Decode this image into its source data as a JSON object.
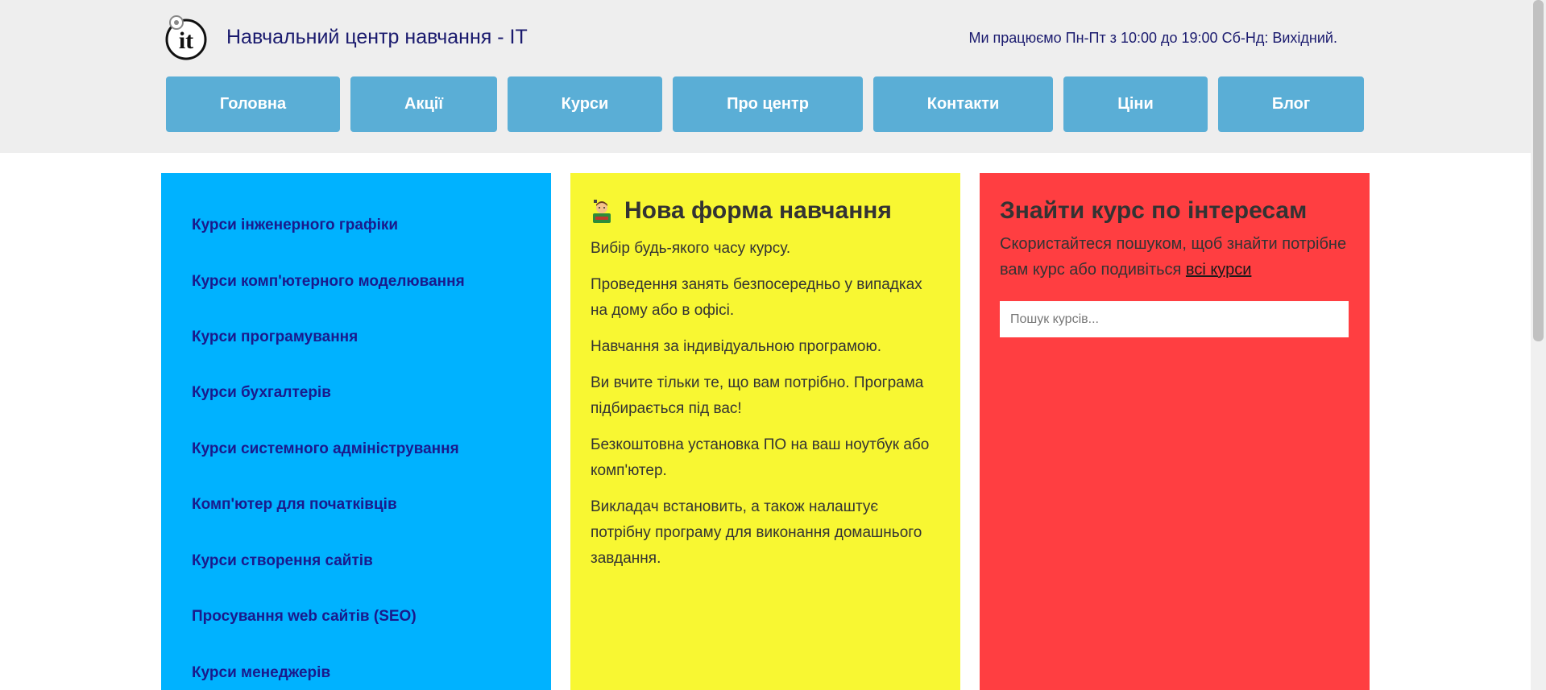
{
  "header": {
    "title": "Навчальний центр навчання - IT",
    "hours": "Ми працюємо Пн-Пт з 10:00 до 19:00 Сб-Нд: Вихідний.",
    "logo_text": "it"
  },
  "nav": [
    {
      "label": "Головна"
    },
    {
      "label": "Акції"
    },
    {
      "label": "Курси"
    },
    {
      "label": "Про центр"
    },
    {
      "label": "Контакти"
    },
    {
      "label": "Ціни"
    },
    {
      "label": "Блог"
    }
  ],
  "courses": [
    {
      "label": "Курси інженерного графіки"
    },
    {
      "label": "Курси комп'ютерного моделювання"
    },
    {
      "label": "Курси програмування"
    },
    {
      "label": "Курси бухгалтерів"
    },
    {
      "label": "Курси системного адміністрування"
    },
    {
      "label": "Комп'ютер для початківців"
    },
    {
      "label": "Курси створення сайтів"
    },
    {
      "label": "Просування web сайтів (SEO)"
    },
    {
      "label": "Курси менеджерів"
    }
  ],
  "new_form": {
    "icon": "teacher-icon",
    "title": "Нова форма навчання",
    "paragraphs": [
      "Вибір будь-якого часу курсу.",
      "Проведення занять безпосередньо у випадках на дому або в офісі.",
      "Навчання за індивідуальною програмою.",
      "Ви вчите тільки те, що вам потрібно. Програма підбирається під вас!",
      "Безкоштовна установка ПО на ваш ноутбук або комп'ютер.",
      "Викладач встановить, а також налаштує потрібну програму для виконання домашнього завдання."
    ]
  },
  "search": {
    "title": "Знайти курс по інтересам",
    "text": "Скористайтеся пошуком, щоб знайти потрібне вам курс або подивіться",
    "link": "всі курси",
    "placeholder": "Пошук курсів..."
  },
  "colors": {
    "header_bg": "#eeeeee",
    "nav_bg": "#5aaed6",
    "blue": "#00b2ff",
    "yellow": "#f8f732",
    "red": "#ff3e41",
    "link": "#1a1a8c"
  }
}
